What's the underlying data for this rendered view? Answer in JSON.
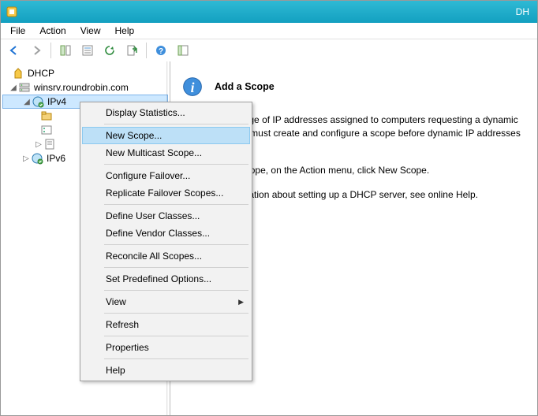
{
  "title": "DH",
  "menubar": {
    "file": "File",
    "action": "Action",
    "view": "View",
    "help": "Help"
  },
  "toolbar": {
    "back": "back",
    "forward": "forward",
    "up": "up",
    "show_hide_tree": "show-hide-tree",
    "properties": "properties",
    "refresh": "refresh",
    "export": "export",
    "help": "help",
    "show_hide_action": "show-hide-action"
  },
  "tree": {
    "root": "DHCP",
    "server": "winsrv.roundrobin.com",
    "ipv4": "IPv4",
    "ipv6": "IPv6"
  },
  "content": {
    "heading": "Add a Scope",
    "p1": "A scope is a range of IP addresses assigned to computers requesting a dynamic IP address. You must create and configure a scope before dynamic IP addresses can be assigned.",
    "p2": "To add a new scope, on the Action menu, click New Scope.",
    "p3": "For more information about setting up a DHCP server, see online Help."
  },
  "context_menu": {
    "display_stats": "Display Statistics...",
    "new_scope": "New Scope...",
    "new_multicast": "New Multicast Scope...",
    "configure_failover": "Configure Failover...",
    "replicate_failover": "Replicate Failover Scopes...",
    "define_user": "Define User Classes...",
    "define_vendor": "Define Vendor Classes...",
    "reconcile": "Reconcile All Scopes...",
    "set_predefined": "Set Predefined Options...",
    "view": "View",
    "refresh": "Refresh",
    "properties": "Properties",
    "help": "Help"
  }
}
